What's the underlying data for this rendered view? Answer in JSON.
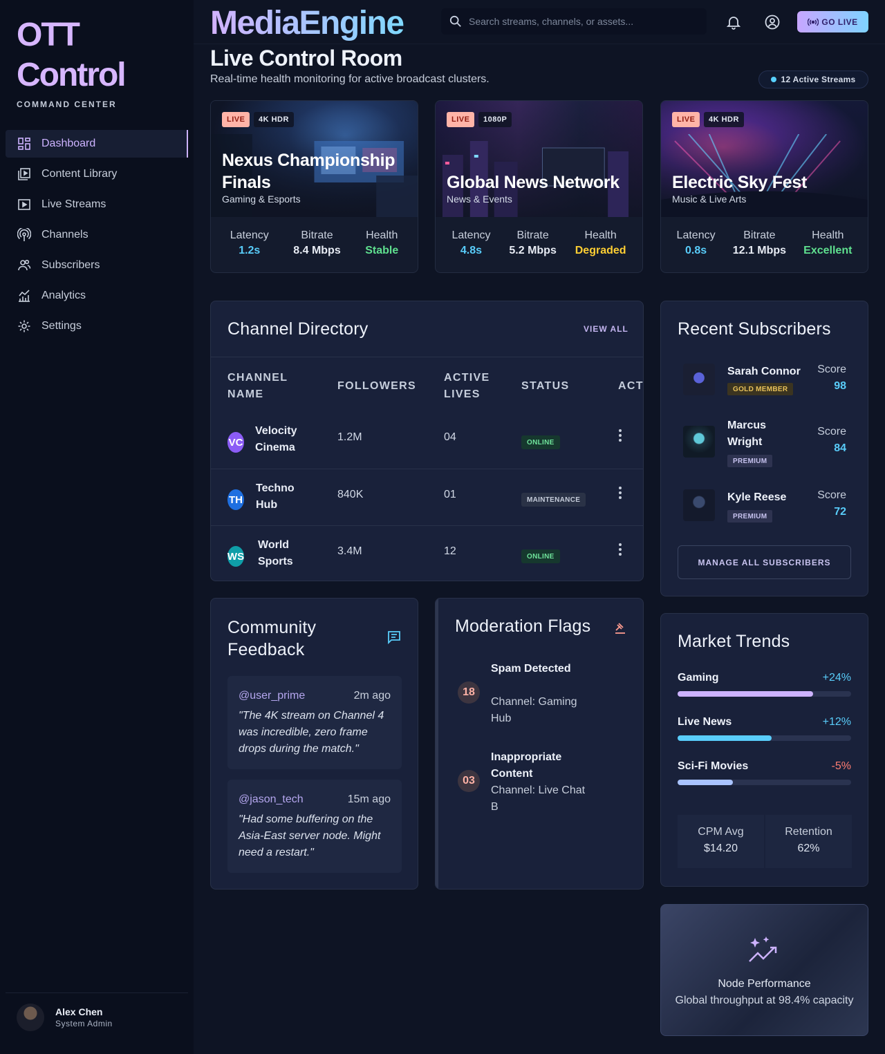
{
  "sidebar": {
    "brand_line1": "OTT",
    "brand_line2": "Control",
    "brand_sub": "COMMAND CENTER",
    "items": [
      {
        "label": "Dashboard",
        "icon": "dashboard-icon",
        "active": true
      },
      {
        "label": "Content Library",
        "icon": "library-icon"
      },
      {
        "label": "Live Streams",
        "icon": "play-icon"
      },
      {
        "label": "Channels",
        "icon": "antenna-icon"
      },
      {
        "label": "Subscribers",
        "icon": "users-icon"
      },
      {
        "label": "Analytics",
        "icon": "chart-icon"
      },
      {
        "label": "Settings",
        "icon": "gear-icon"
      }
    ],
    "user": {
      "name": "Alex Chen",
      "role": "System Admin"
    }
  },
  "header": {
    "logo": "MediaEngine",
    "search_placeholder": "Search streams, channels, or assets...",
    "go_live": "GO LIVE"
  },
  "page": {
    "title": "Live Control Room",
    "subtitle": "Real-time health monitoring for active broadcast clusters.",
    "active_streams": "12 Active Streams"
  },
  "streams": [
    {
      "badge": "LIVE",
      "resolution": "4K HDR",
      "title": "Nexus Championship Finals",
      "category": "Gaming & Esports",
      "latency_label": "Latency",
      "latency": "1.2s",
      "bitrate_label": "Bitrate",
      "bitrate": "8.4 Mbps",
      "health_label": "Health",
      "health": "Stable",
      "health_color": "#5fe08f"
    },
    {
      "badge": "LIVE",
      "resolution": "1080P",
      "title": "Global News Network",
      "category": "News & Events",
      "latency_label": "Latency",
      "latency": "4.8s",
      "bitrate_label": "Bitrate",
      "bitrate": "5.2 Mbps",
      "health_label": "Health",
      "health": "Degraded",
      "health_color": "#ffcf33"
    },
    {
      "badge": "LIVE",
      "resolution": "4K HDR",
      "title": "Electric Sky Fest",
      "category": "Music & Live Arts",
      "latency_label": "Latency",
      "latency": "0.8s",
      "bitrate_label": "Bitrate",
      "bitrate": "12.1 Mbps",
      "health_label": "Health",
      "health": "Excellent",
      "health_color": "#5fe08f"
    }
  ],
  "directory": {
    "title": "Channel Directory",
    "view_all": "VIEW ALL",
    "columns": [
      "CHANNEL NAME",
      "FOLLOWERS",
      "ACTIVE LIVES",
      "STATUS",
      "ACT"
    ],
    "rows": [
      {
        "initials": "VC",
        "color": "#8b5cf6",
        "name": "Velocity Cinema",
        "followers": "1.2M",
        "lives": "04",
        "status": "ONLINE"
      },
      {
        "initials": "TH",
        "color": "#1e6fe0",
        "name": "Techno Hub",
        "followers": "840K",
        "lives": "01",
        "status": "MAINTENANCE"
      },
      {
        "initials": "WS",
        "color": "#0f9ea8",
        "name": "World Sports",
        "followers": "3.4M",
        "lives": "12",
        "status": "ONLINE"
      }
    ]
  },
  "subscribers": {
    "title": "Recent Subscribers",
    "score_label": "Score",
    "items": [
      {
        "name": "Sarah Connor",
        "badge": "GOLD MEMBER",
        "score": "98"
      },
      {
        "name": "Marcus Wright",
        "badge": "PREMIUM",
        "score": "84"
      },
      {
        "name": "Kyle Reese",
        "badge": "PREMIUM",
        "score": "72"
      }
    ],
    "manage": "MANAGE ALL SUBSCRIBERS"
  },
  "feedback": {
    "title": "Community Feedback",
    "items": [
      {
        "user": "@user_prime",
        "time": "2m ago",
        "text": "\"The 4K stream on Channel 4 was incredible, zero frame drops during the match.\""
      },
      {
        "user": "@jason_tech",
        "time": "15m ago",
        "text": "\"Had some buffering on the Asia-East server node. Might need a restart.\""
      }
    ]
  },
  "moderation": {
    "title": "Moderation Flags",
    "items": [
      {
        "count": "18",
        "title": "Spam Detected",
        "desc": "Channel: Gaming Hub"
      },
      {
        "count": "03",
        "title": "Inappropriate Content",
        "desc": "Channel: Live Chat B"
      }
    ]
  },
  "market": {
    "title": "Market Trends",
    "trends": [
      {
        "label": "Gaming",
        "value": "+24%",
        "color": "#59cdfa",
        "fill_pct": 78,
        "bar": "#cdb3ff"
      },
      {
        "label": "Live News",
        "value": "+12%",
        "color": "#59cdfa",
        "fill_pct": 54,
        "bar": "#59cdfa"
      },
      {
        "label": "Sci-Fi Movies",
        "value": "-5%",
        "color": "#ff7d72",
        "fill_pct": 32,
        "bar": "#a9c3ff"
      }
    ],
    "kpis": [
      {
        "label": "CPM Avg",
        "value": "$14.20"
      },
      {
        "label": "Retention",
        "value": "62%"
      }
    ]
  },
  "node": {
    "title": "Node Performance",
    "subtitle": "Global throughput at 98.4% capacity"
  }
}
